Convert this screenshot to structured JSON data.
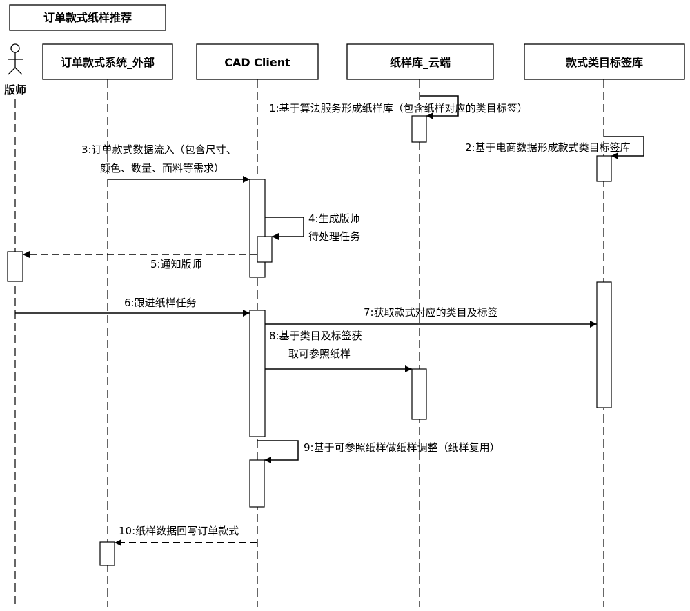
{
  "frame_title": "订单款式纸样推荐",
  "actor": {
    "label": "版师"
  },
  "participants": [
    {
      "id": "order",
      "label": "订单款式系统_外部"
    },
    {
      "id": "cad",
      "label": "CAD Client"
    },
    {
      "id": "pattern",
      "label": "纸样库_云端"
    },
    {
      "id": "tags",
      "label": "款式类目标签库"
    }
  ],
  "messages": [
    {
      "n": 1,
      "lines": [
        "1:基于算法服务形成纸样库（包含纸样对应的类目标签）"
      ],
      "from": "pattern",
      "to": "pattern",
      "style": "solid"
    },
    {
      "n": 2,
      "lines": [
        "2:基于电商数据形成款式类目标签库"
      ],
      "from": "tags",
      "to": "tags",
      "style": "solid"
    },
    {
      "n": 3,
      "lines": [
        "3:订单款式数据流入（包含尺寸、",
        "颜色、数量、面料等需求）"
      ],
      "from": "order",
      "to": "cad",
      "style": "solid"
    },
    {
      "n": 4,
      "lines": [
        "4:生成版师",
        "待处理任务"
      ],
      "from": "cad",
      "to": "cad",
      "style": "solid"
    },
    {
      "n": 5,
      "lines": [
        "5:通知版师"
      ],
      "from": "cad",
      "to": "actor",
      "style": "dashed"
    },
    {
      "n": 6,
      "lines": [
        "6:跟进纸样任务"
      ],
      "from": "actor",
      "to": "cad",
      "style": "solid"
    },
    {
      "n": 7,
      "lines": [
        "7:获取款式对应的类目及标签"
      ],
      "from": "cad",
      "to": "tags",
      "style": "solid"
    },
    {
      "n": 8,
      "lines": [
        "8:基于类目及标签获",
        "取可参照纸样"
      ],
      "from": "cad",
      "to": "pattern",
      "style": "solid"
    },
    {
      "n": 9,
      "lines": [
        "9:基于可参照纸样做纸样调整（纸样复用）"
      ],
      "from": "cad",
      "to": "cad",
      "style": "solid"
    },
    {
      "n": 10,
      "lines": [
        "10:纸样数据回写订单款式"
      ],
      "from": "cad",
      "to": "order",
      "style": "dashed"
    }
  ]
}
